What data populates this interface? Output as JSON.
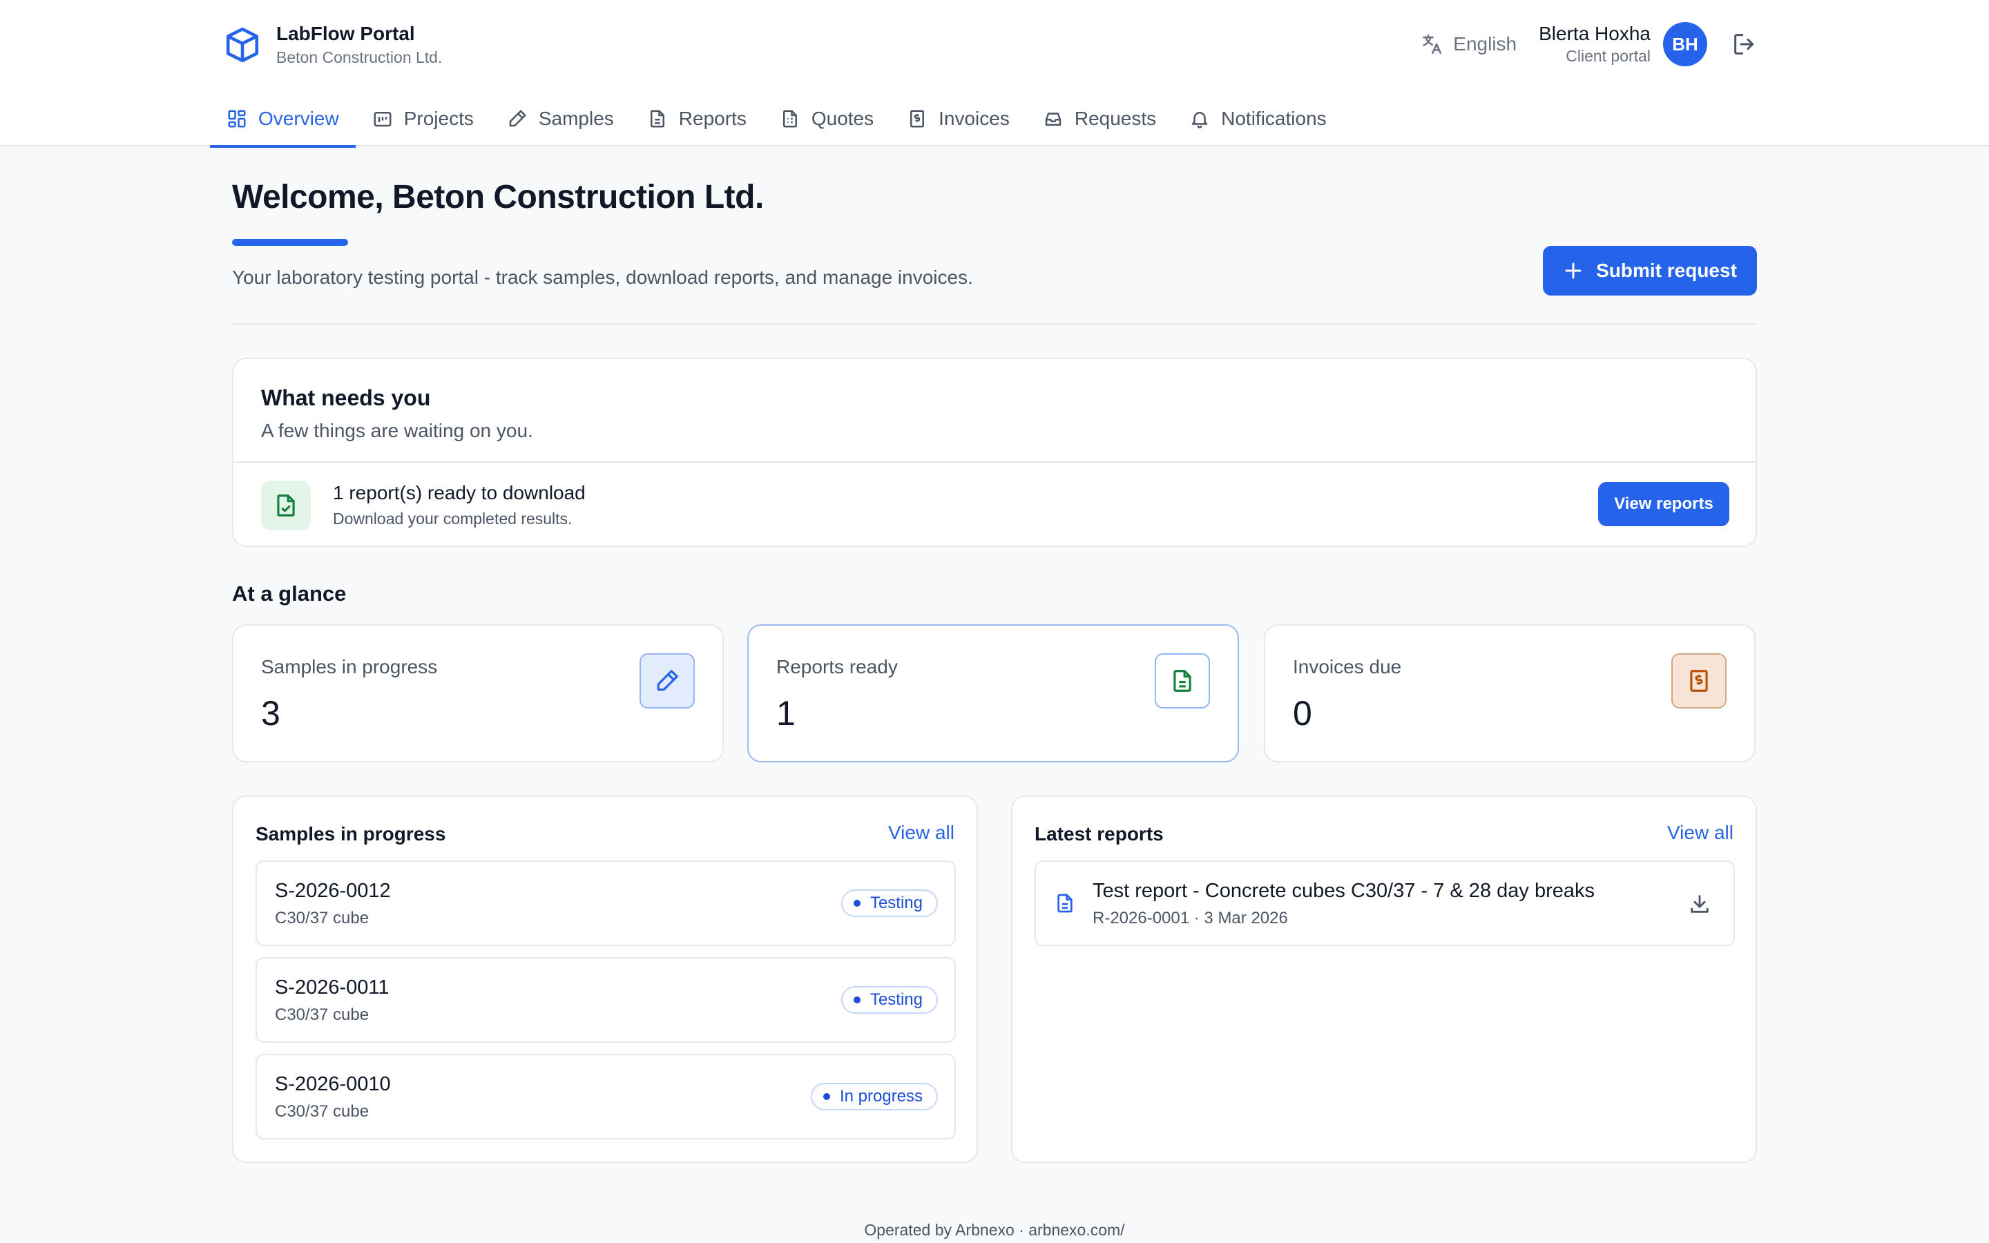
{
  "app": {
    "title": "LabFlow Portal",
    "org": "Beton Construction Ltd."
  },
  "header": {
    "language": "English",
    "user_name": "Blerta Hoxha",
    "user_role": "Client portal",
    "avatar_initials": "BH"
  },
  "nav": {
    "tabs": [
      {
        "label": "Overview",
        "icon": "overview-icon",
        "active": true
      },
      {
        "label": "Projects",
        "icon": "projects-icon"
      },
      {
        "label": "Samples",
        "icon": "pencil-icon"
      },
      {
        "label": "Reports",
        "icon": "document-icon"
      },
      {
        "label": "Quotes",
        "icon": "quote-document-icon"
      },
      {
        "label": "Invoices",
        "icon": "invoice-icon"
      },
      {
        "label": "Requests",
        "icon": "inbox-icon"
      },
      {
        "label": "Notifications",
        "icon": "bell-icon"
      }
    ]
  },
  "welcome": {
    "title": "Welcome, Beton Construction Ltd.",
    "subtitle": "Your laboratory testing portal - track samples, download reports, and manage invoices.",
    "submit_label": "Submit request"
  },
  "needs": {
    "title": "What needs you",
    "subtitle": "A few things are waiting on you.",
    "item_title": "1 report(s) ready to download",
    "item_subtitle": "Download your completed results.",
    "item_button": "View reports"
  },
  "glance": {
    "title": "At a glance",
    "stats": [
      {
        "label": "Samples in progress",
        "value": "3",
        "icon": "pencil-icon"
      },
      {
        "label": "Reports ready",
        "value": "1",
        "icon": "document-icon"
      },
      {
        "label": "Invoices due",
        "value": "0",
        "icon": "invoice-icon"
      }
    ]
  },
  "samples_panel": {
    "title": "Samples in progress",
    "link": "View all",
    "items": [
      {
        "id": "S-2026-0012",
        "desc": "C30/37 cube",
        "status": "Testing"
      },
      {
        "id": "S-2026-0011",
        "desc": "C30/37 cube",
        "status": "Testing"
      },
      {
        "id": "S-2026-0010",
        "desc": "C30/37 cube",
        "status": "In progress"
      }
    ]
  },
  "reports_panel": {
    "title": "Latest reports",
    "link": "View all",
    "items": [
      {
        "title": "Test report - Concrete cubes C30/37 - 7 & 28 day breaks",
        "meta": "R-2026-0001 · 3 Mar 2026"
      }
    ]
  },
  "footer": {
    "text": "Operated by Arbnexo · arbnexo.com/"
  },
  "colors": {
    "accent": "#2563eb",
    "success_bg": "#e3f4e8",
    "success": "#15803d",
    "invoice": "#b45309"
  }
}
